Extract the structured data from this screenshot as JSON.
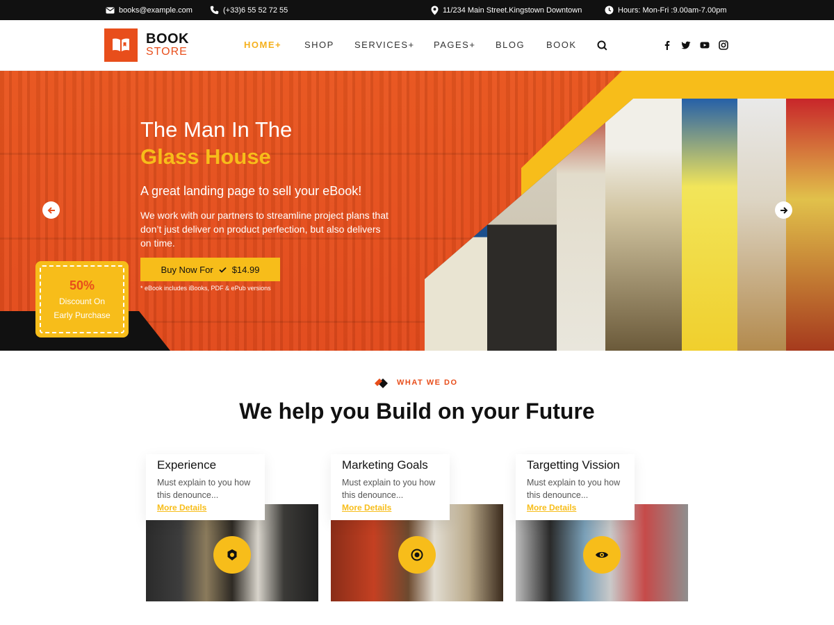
{
  "topbar": {
    "email": "books@example.com",
    "phone": "(+33)6 55 52 72 55",
    "address": "11/234 Main Street.Kingstown Downtown",
    "hours": "Hours: Mon-Fri :9.00am-7.00pm"
  },
  "logo": {
    "line1": "BOOK",
    "line2": "STORE"
  },
  "nav": {
    "items": [
      {
        "label": "HOME+"
      },
      {
        "label": "SHOP"
      },
      {
        "label": "SERVICES+"
      },
      {
        "label": "PAGES+"
      },
      {
        "label": "BLOG"
      },
      {
        "label": "BOOK"
      }
    ]
  },
  "socials": [
    "facebook-icon",
    "twitter-icon",
    "youtube-icon",
    "instagram-icon"
  ],
  "hero": {
    "title_line1": "The Man In The",
    "title_line2": "Glass House",
    "subtitle": "A great landing page to sell your eBook!",
    "description": "We work with our partners to streamline project plans that don’t just deliver on product perfection, but also delivers on time.",
    "buy_label": "Buy Now For",
    "price": "$14.99",
    "note": "* eBook includes iBooks, PDF & ePub versions"
  },
  "discount": {
    "percent": "50%",
    "line1": "Discount On",
    "line2": "Early Purchase"
  },
  "what_we_do": {
    "label": "WHAT WE DO",
    "title": "We help you Build on your Future"
  },
  "cards": [
    {
      "title": "Experience",
      "text": "Must explain to you how this denounce...",
      "link": "More Details"
    },
    {
      "title": "Marketing Goals",
      "text": "Must explain to you how this denounce...",
      "link": "More Details"
    },
    {
      "title": "Targetting Vission",
      "text": "Must explain to you how this denounce...",
      "link": "More Details"
    }
  ],
  "colors": {
    "accent": "#e84e1b",
    "yellow": "#f7bd1a",
    "dark": "#111111"
  }
}
